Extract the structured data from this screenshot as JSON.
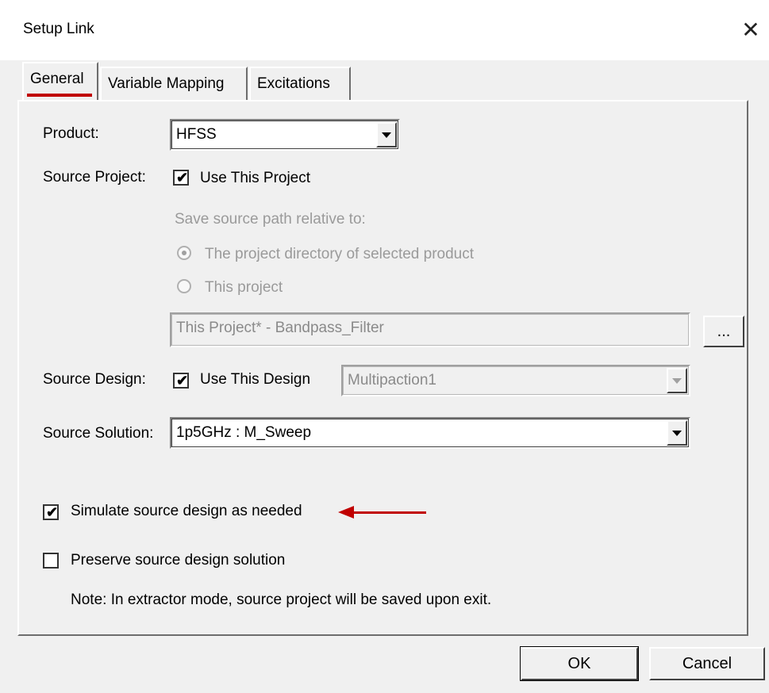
{
  "window": {
    "title": "Setup Link",
    "close_glyph": "✕"
  },
  "tabs": [
    {
      "label": "General",
      "active": true
    },
    {
      "label": "Variable Mapping",
      "active": false
    },
    {
      "label": "Excitations",
      "active": false
    }
  ],
  "general": {
    "product_label": "Product:",
    "product_value": "HFSS",
    "source_project_label": "Source Project:",
    "use_this_project_label": "Use This Project",
    "use_this_project_checked": true,
    "save_path_caption": "Save source path relative to:",
    "radio_project_dir_label": "The project directory of selected product",
    "radio_this_project_label": "This project",
    "project_path_value": "This Project* - Bandpass_Filter",
    "browse_label": "...",
    "source_design_label": "Source Design:",
    "use_this_design_label": "Use This Design",
    "use_this_design_checked": true,
    "design_value": "Multipaction1",
    "source_solution_label": "Source Solution:",
    "solution_value": "1p5GHz : M_Sweep",
    "simulate_label": "Simulate source design as needed",
    "simulate_checked": true,
    "preserve_label": "Preserve source design solution",
    "preserve_checked": false,
    "note": "Note: In extractor mode, source project will be saved upon exit.",
    "checkmark_glyph": "✔"
  },
  "buttons": {
    "ok": "OK",
    "cancel": "Cancel"
  },
  "colors": {
    "annotation_red": "#c00000",
    "dialog_bg": "#f0f0f0"
  }
}
